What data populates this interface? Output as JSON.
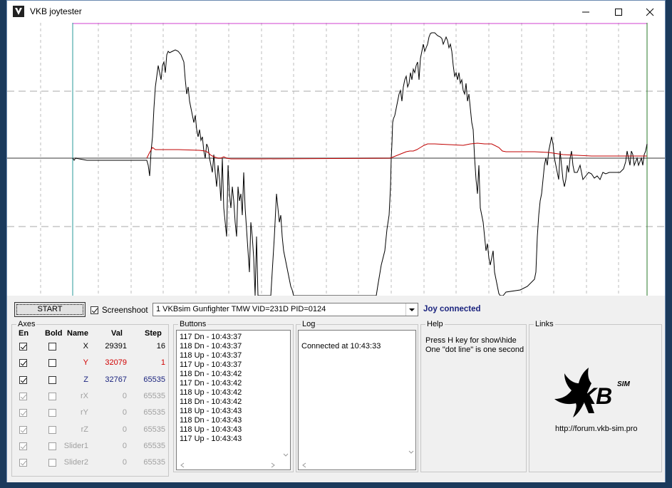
{
  "window": {
    "title": "VKB joytester"
  },
  "toolbar": {
    "start_label": "START",
    "screenshot_label": "Screenshoot",
    "screenshot_checked": true,
    "device_selected": "1  VKBsim Gunfighter TMW  VID=231D PID=0124",
    "status": "Joy connected"
  },
  "axes": {
    "title": "Axes",
    "headers": {
      "en": "En",
      "bold": "Bold",
      "name": "Name",
      "val": "Val",
      "step": "Step"
    },
    "rows": [
      {
        "name": "X",
        "val": "29391",
        "step": "16",
        "enabled": true,
        "bold": false,
        "active": true,
        "color": "#000000"
      },
      {
        "name": "Y",
        "val": "32079",
        "step": "1",
        "enabled": true,
        "bold": false,
        "active": true,
        "color": "#d00000"
      },
      {
        "name": "Z",
        "val": "32767",
        "step": "65535",
        "enabled": true,
        "bold": false,
        "active": true,
        "color": "#1a237e"
      },
      {
        "name": "rX",
        "val": "0",
        "step": "65535",
        "enabled": true,
        "bold": false,
        "active": false,
        "color": "#a0a0a0"
      },
      {
        "name": "rY",
        "val": "0",
        "step": "65535",
        "enabled": true,
        "bold": false,
        "active": false,
        "color": "#a0a0a0"
      },
      {
        "name": "rZ",
        "val": "0",
        "step": "65535",
        "enabled": true,
        "bold": false,
        "active": false,
        "color": "#a0a0a0"
      },
      {
        "name": "Slider1",
        "val": "0",
        "step": "65535",
        "enabled": true,
        "bold": false,
        "active": false,
        "color": "#a0a0a0"
      },
      {
        "name": "Slider2",
        "val": "0",
        "step": "65535",
        "enabled": true,
        "bold": false,
        "active": false,
        "color": "#a0a0a0"
      }
    ]
  },
  "buttons": {
    "title": "Buttons",
    "items": [
      "117 Dn - 10:43:37",
      "118 Dn - 10:43:37",
      "118 Up - 10:43:37",
      "117 Up - 10:43:37",
      "118 Dn - 10:43:42",
      "117 Dn - 10:43:42",
      "118 Up - 10:43:42",
      "118 Dn - 10:43:42",
      "118 Up - 10:43:43",
      "118 Dn - 10:43:43",
      "118 Up - 10:43:43",
      "117 Up - 10:43:43"
    ]
  },
  "log": {
    "title": "Log",
    "text": "Connected at 10:43:33"
  },
  "help": {
    "title": "Help",
    "line1": "Press H key for show\\hide",
    "line2": "One \"dot line\" is one second"
  },
  "links": {
    "title": "Links",
    "url": "http://forum.vkb-sim.pro",
    "logo_text": "KB",
    "logo_sup": "SIM"
  },
  "colors": {
    "axis_x": "#000000",
    "axis_y": "#c00000",
    "accent": "#1a237e"
  },
  "icons": {
    "app": "vkb-app-icon",
    "minimize": "minimize-icon",
    "maximize": "maximize-icon",
    "close": "close-icon"
  }
}
